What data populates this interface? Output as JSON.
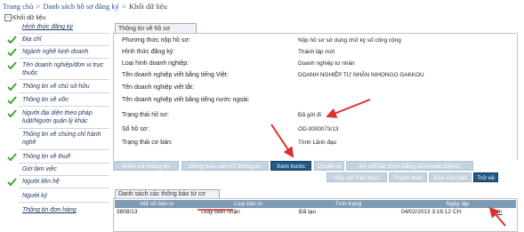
{
  "breadcrumb": {
    "home": "Trang chủ",
    "sep": ">",
    "list": "Danh sách hồ sơ đăng ký",
    "current": "Khối dữ liệu"
  },
  "sidebar": {
    "root_label": "Khối dữ liệu",
    "root_toggle": "−",
    "items": [
      {
        "label": "Hình thức đăng ký",
        "checked": false
      },
      {
        "label": "Địa chỉ",
        "checked": true
      },
      {
        "label": "Ngành nghề kinh doanh",
        "checked": true
      },
      {
        "label": "Tên doanh nghiệp/đơn vị trực thuộc",
        "checked": true
      },
      {
        "label": "Thông tin về chủ sở hữu",
        "checked": true
      },
      {
        "label": "Thông tin về vốn",
        "checked": true
      },
      {
        "label": "Người đại diện theo pháp luật/Người quản lý khác",
        "checked": true
      },
      {
        "label": "Thông tin về chứng chỉ hành nghề",
        "checked": false
      },
      {
        "label": "Thông tin về thuế",
        "checked": true
      },
      {
        "label": "Giờ làm việc",
        "checked": false
      },
      {
        "label": "Người liên hệ",
        "checked": true
      },
      {
        "label": "Người ký",
        "checked": false
      },
      {
        "label": "Thông tin đơn hàng",
        "checked": false
      }
    ]
  },
  "section": {
    "tab_label": "Thông tin về hồ sơ",
    "rows": [
      {
        "label": "Phương thức nộp hồ sơ:",
        "value": "Nộp hồ sơ sử dụng chữ ký số công cộng"
      },
      {
        "label": "Hình thức đăng ký:",
        "value": "Thành lập mới"
      },
      {
        "label": "Loại hình doanh nghiệp:",
        "value": "Doanh nghiệp tư nhân"
      },
      {
        "label": "Tên doanh nghiệp viết bằng tiếng Việt:",
        "value": "DOANH NGHIỆP TƯ NHÂN NIHONGO GAKKOU"
      },
      {
        "label": "Tên doanh nghiệp viết tắt:",
        "value": ""
      },
      {
        "label": "Tên doanh nghiệp viết bằng tiếng nước ngoài:",
        "value": ""
      },
      {
        "label": "Trạng thái hồ sơ:",
        "value": "Đã gửi đi"
      },
      {
        "label": "Số hồ sơ:",
        "value": "OD-0000073/13"
      },
      {
        "label": "Trạng thái cơ bản:",
        "value": "Trình Lãnh đạo"
      }
    ]
  },
  "buttons": {
    "row1": [
      "Kiểm tra thông tin",
      "Đóng báo cáo KT thông tin",
      "Xem trước",
      "Chuẩn bị",
      "Ký số/Xác thực bằng tài khoản ĐKKD"
    ],
    "row2": [
      "Hủy ký/ Xác thực",
      "Thanh toán",
      "Xóa văn bản",
      "Trở về"
    ]
  },
  "notices": {
    "tab_label": "Danh sách các thông báo từ cơ quan ĐKKD",
    "columns": [
      "Mã số bản in",
      "Loại bản in",
      "Tình trạng",
      "Ngày lập"
    ],
    "rows": [
      {
        "code": "3808/13",
        "type": "Giấy biên nhận",
        "status": "Đã tạo",
        "date": "04/02/2013 3:16:12 CH",
        "action": "In"
      }
    ]
  },
  "colors": {
    "link": "#2a4f8c",
    "check": "#3ea82f",
    "arrow": "#e0302a",
    "button_disabled": "#c4d3df",
    "button_active": "#1f5b87",
    "table_header": "#7e9bb6"
  }
}
